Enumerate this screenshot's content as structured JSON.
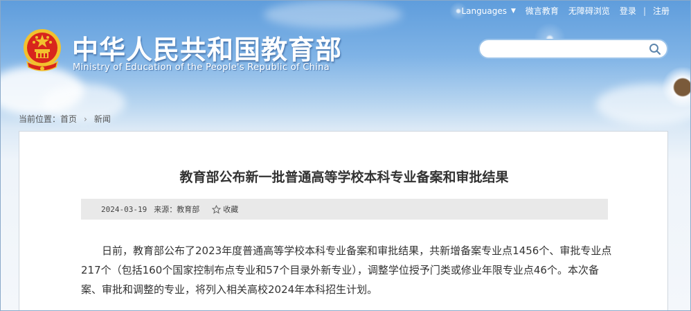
{
  "topnav": {
    "languages": "Languages",
    "weibo": "微言教育",
    "accessibility": "无障碍浏览",
    "login": "登录",
    "separator": "|",
    "register": "注册"
  },
  "header": {
    "title": "中华人民共和国教育部",
    "subtitle": "Ministry of Education of the People's Republic of China"
  },
  "search": {
    "placeholder": ""
  },
  "breadcrumb": {
    "prefix": "当前位置：",
    "home": "首页",
    "arrow": "›",
    "current": "新闻"
  },
  "article": {
    "title": "教育部公布新一批普通高等学校本科专业备案和审批结果",
    "date": "2024-03-19",
    "source": "来源：教育部",
    "favorite": "收藏",
    "body": "日前，教育部公布了2023年度普通高等学校本科专业备案和审批结果，共新增备案专业点1456个、审批专业点217个（包括160个国家控制布点专业和57个目录外新专业），调整学位授予门类或修业年限专业点46个。本次备案、审批和调整的专业，将列入相关高校2024年本科招生计划。"
  },
  "colors": {
    "sky": "#6aa6e0",
    "emblem_red": "#d8251c",
    "emblem_gold": "#f2c12e"
  }
}
